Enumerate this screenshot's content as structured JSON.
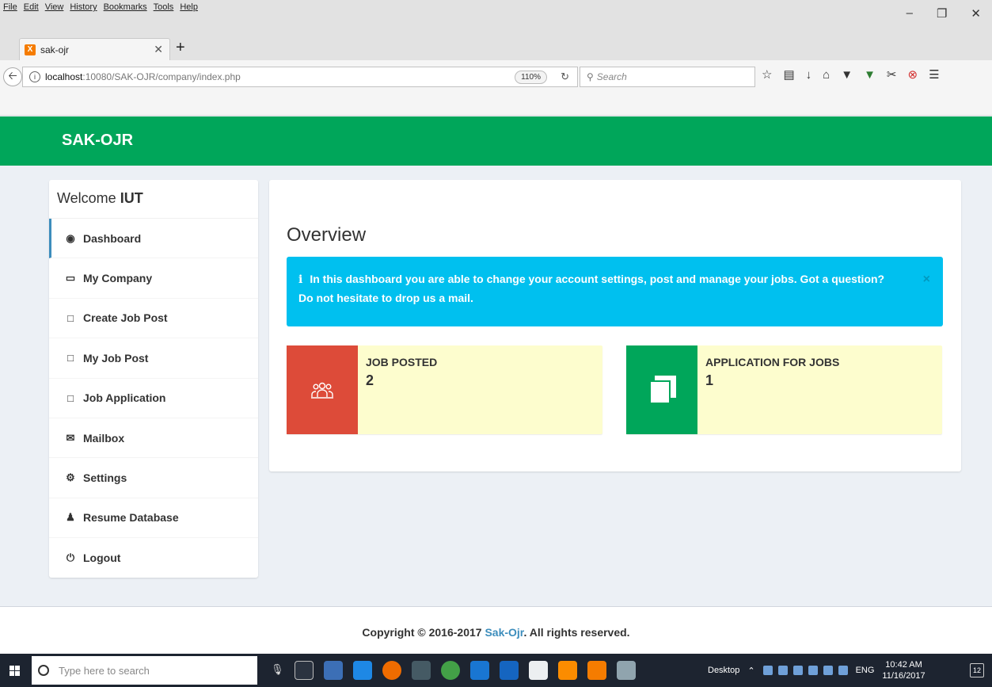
{
  "browser": {
    "menu": [
      "File",
      "Edit",
      "View",
      "History",
      "Bookmarks",
      "Tools",
      "Help"
    ],
    "tab_title": "sak-ojr",
    "url_host": "localhost",
    "url_path": ":10080/SAK-OJR/company/index.php",
    "zoom": "110%",
    "search_placeholder": "Search"
  },
  "header": {
    "brand": "SAK-OJR",
    "color": "#00a65a"
  },
  "sidebar": {
    "welcome_prefix": "Welcome",
    "welcome_user": "IUT",
    "items": [
      {
        "label": "Dashboard",
        "icon": "dashboard-icon",
        "active": true
      },
      {
        "label": "My Company",
        "icon": "desktop-icon"
      },
      {
        "label": "Create Job Post",
        "icon": "file-icon"
      },
      {
        "label": "My Job Post",
        "icon": "file-icon"
      },
      {
        "label": "Job Application",
        "icon": "file-icon"
      },
      {
        "label": "Mailbox",
        "icon": "envelope-icon"
      },
      {
        "label": "Settings",
        "icon": "gear-icon"
      },
      {
        "label": "Resume Database",
        "icon": "user-icon"
      },
      {
        "label": "Logout",
        "icon": "power-icon"
      }
    ]
  },
  "main": {
    "title": "Overview",
    "alert_text": "In this dashboard you are able to change your account settings, post and manage your jobs. Got a question? Do not hesitate to drop us a mail.",
    "alert_close": "×",
    "boxes": [
      {
        "label": "JOB POSTED",
        "value": "2",
        "icon": "users-icon",
        "color": "#dd4b39"
      },
      {
        "label": "APPLICATION FOR JOBS",
        "value": "1",
        "icon": "copy-icon",
        "color": "#00a65a"
      }
    ]
  },
  "footer": {
    "prefix": "Copyright © 2016-2017",
    "link": "Sak-Ojr",
    "suffix": ". All rights reserved."
  },
  "taskbar": {
    "search_placeholder": "Type here to search",
    "desktop_label": "Desktop",
    "language": "ENG",
    "time": "10:42 AM",
    "date": "11/16/2017",
    "notifications": "12"
  }
}
